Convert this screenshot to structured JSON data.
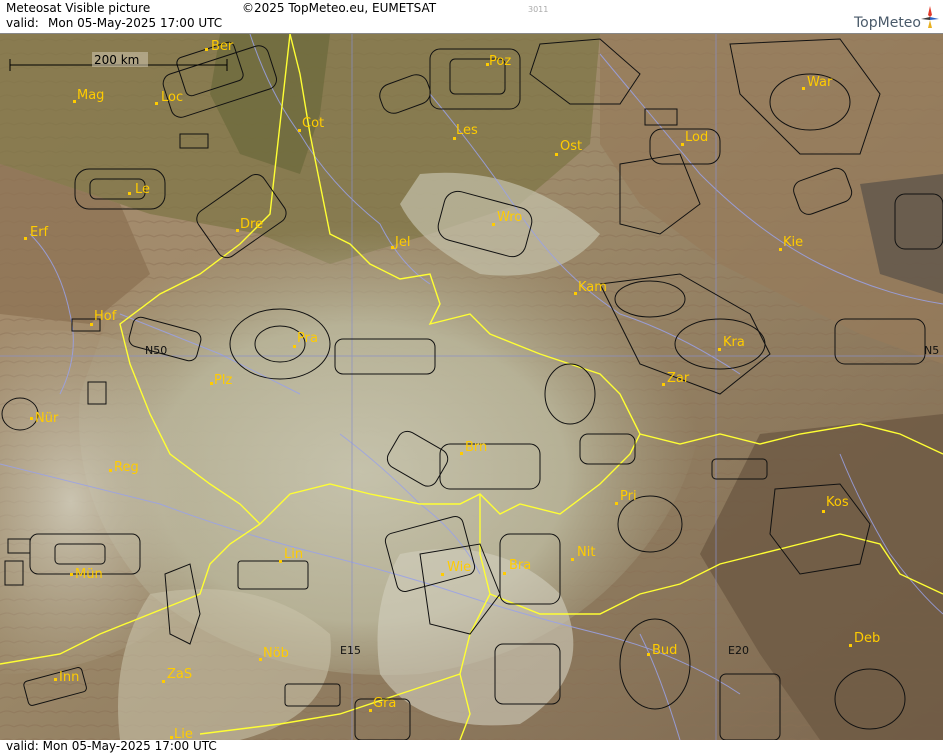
{
  "header": {
    "title": "Meteosat Visible picture",
    "copyright": "©2025 TopMeteo.eu, EUMETSAT",
    "valid_prefix": "valid:",
    "valid_time": "Mon  05-May-2025  17:00 UTC",
    "frame_code": "3011",
    "brand": "TopMeteo"
  },
  "scale_bar": {
    "label": "200 km"
  },
  "grid_labels": {
    "lat": "N50",
    "lat_right": "N5",
    "lon1": "E15",
    "lon2": "E20"
  },
  "cities": [
    {
      "name": "Ber"
    },
    {
      "name": "Poz"
    },
    {
      "name": "War"
    },
    {
      "name": "Mag"
    },
    {
      "name": "Loc"
    },
    {
      "name": "Cot"
    },
    {
      "name": "Les"
    },
    {
      "name": "Ost"
    },
    {
      "name": "Lod"
    },
    {
      "name": "Le"
    },
    {
      "name": "Wro"
    },
    {
      "name": "Dre"
    },
    {
      "name": "Erf"
    },
    {
      "name": "Jel"
    },
    {
      "name": "Kie"
    },
    {
      "name": "Kam"
    },
    {
      "name": "Hof"
    },
    {
      "name": "Pra"
    },
    {
      "name": "Kra"
    },
    {
      "name": "Zar"
    },
    {
      "name": "Plz"
    },
    {
      "name": "Nür"
    },
    {
      "name": "Brn"
    },
    {
      "name": "Reg"
    },
    {
      "name": "Pri"
    },
    {
      "name": "Kos"
    },
    {
      "name": "Lin"
    },
    {
      "name": "Nit"
    },
    {
      "name": "Wie"
    },
    {
      "name": "Bra"
    },
    {
      "name": "Mün"
    },
    {
      "name": "Nöb"
    },
    {
      "name": "Bud"
    },
    {
      "name": "Deb"
    },
    {
      "name": "Inn"
    },
    {
      "name": "ZaS"
    },
    {
      "name": "Gra"
    },
    {
      "name": "Lie"
    }
  ],
  "footer": {
    "valid_text": "valid:  Mon  05-May-2025  17:00 UTC"
  }
}
